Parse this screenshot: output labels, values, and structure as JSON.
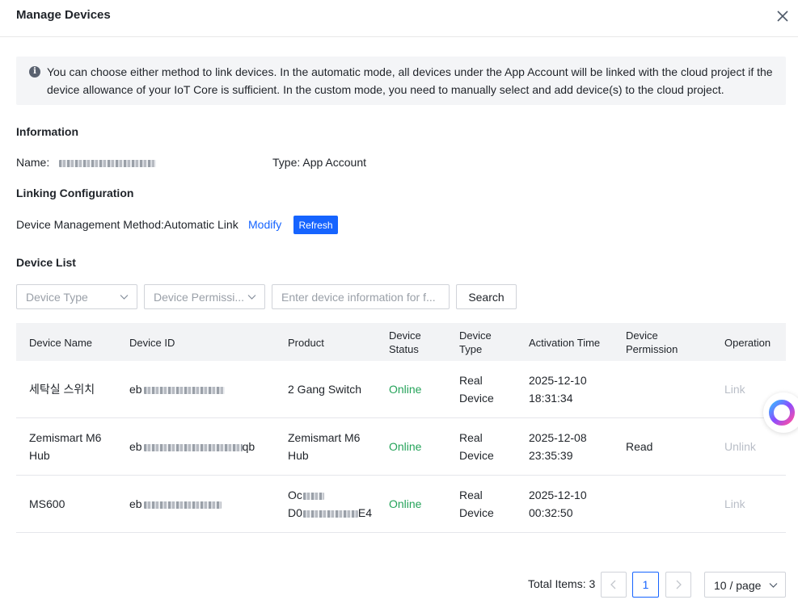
{
  "modal": {
    "title": "Manage Devices"
  },
  "notice": {
    "text": "You can choose either method to link devices. In the automatic mode, all devices under the App Account will be linked with the cloud project if the device allowance of your IoT Core is sufficient. In the custom mode, you need to manually select and add device(s) to the cloud project."
  },
  "information": {
    "title": "Information",
    "name_label": "Name:",
    "type_label": "Type:",
    "type_value": "App Account"
  },
  "linking": {
    "title": "Linking Configuration",
    "method_label": "Device Management Method:",
    "method_value": "Automatic Link",
    "modify_label": "Modify",
    "refresh_label": "Refresh"
  },
  "device_list": {
    "title": "Device List",
    "filter_type_placeholder": "Device Type",
    "filter_permission_placeholder": "Device Permissi...",
    "search_placeholder": "Enter device information for f...",
    "search_label": "Search"
  },
  "table": {
    "columns": {
      "name": "Device Name",
      "id": "Device ID",
      "product": "Product",
      "status_1": "Device",
      "status_2": "Status",
      "type_1": "Device",
      "type_2": "Type",
      "activation": "Activation Time",
      "permission_1": "Device",
      "permission_2": "Permission",
      "operation": "Operation"
    },
    "rows": [
      {
        "name_1": "세탁실 스위치",
        "name_2": "",
        "id_prefix": "eb",
        "id_suffix": "",
        "product_1": "2 Gang Switch",
        "product_2": "",
        "status": "Online",
        "type_1": "Real",
        "type_2": "Device",
        "time_1": "2025-12-10",
        "time_2": "18:31:34",
        "permission": "",
        "operation": "Link"
      },
      {
        "name_1": "Zemismart M6",
        "name_2": "Hub",
        "id_prefix": "eb",
        "id_suffix": "qb",
        "product_1": "Zemismart M6",
        "product_2": "Hub",
        "status": "Online",
        "type_1": "Real",
        "type_2": "Device",
        "time_1": "2025-12-08",
        "time_2": "23:35:39",
        "permission": "Read",
        "operation": "Unlink"
      },
      {
        "name_1": "MS600",
        "name_2": "",
        "id_prefix": "eb",
        "id_suffix": "",
        "product_1": "Oc",
        "product_2": "D0",
        "product_2_suffix": "E4",
        "status": "Online",
        "type_1": "Real",
        "type_2": "Device",
        "time_1": "2025-12-10",
        "time_2": "00:32:50",
        "permission": "",
        "operation": "Link"
      }
    ]
  },
  "pagination": {
    "total_label": "Total Items: 3",
    "current_page": "1",
    "page_size": "10 / page"
  },
  "colors": {
    "primary": "#1664ff",
    "online": "#25a35a",
    "disabled": "#b9bec7"
  }
}
